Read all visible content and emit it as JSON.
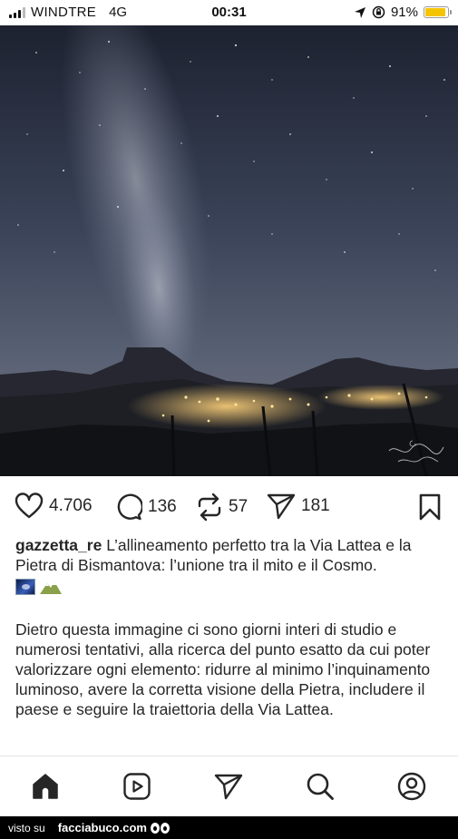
{
  "status_bar": {
    "carrier": "WINDTRE",
    "network": "4G",
    "time": "00:31",
    "battery": "91%",
    "battery_level": 0.91
  },
  "post": {
    "photo_watermark": "Ivano Di Iustino Photography",
    "actions": {
      "likes": "4.706",
      "comments": "136",
      "reposts": "57",
      "shares": "181"
    },
    "caption": {
      "username": "gazzetta_re",
      "text": "L’allineamento perfetto tra la Via Lattea e la Pietra di Bismantova: l’unione tra il mito e il Cosmo.",
      "emojis": [
        "milky-way-emoji",
        "mountain-emoji"
      ]
    },
    "body": "Dietro questa immagine ci sono giorni interi di studio e numerosi tentativi, alla ricerca del punto esatto da cui poter valorizzare ogni elemento: ridurre al minimo l’inquinamento luminoso, avere la corretta visione della Pietra, includere il paese e seguire la traiettoria della Via Lattea."
  },
  "tab_bar": {
    "items": [
      "home",
      "reels",
      "share",
      "search",
      "profile"
    ]
  },
  "footer": {
    "prefix": "visto su",
    "site": "facciabuco.com"
  },
  "colors": {
    "text": "#262626",
    "battery": "#f5c400",
    "footer_bg": "#000000"
  }
}
